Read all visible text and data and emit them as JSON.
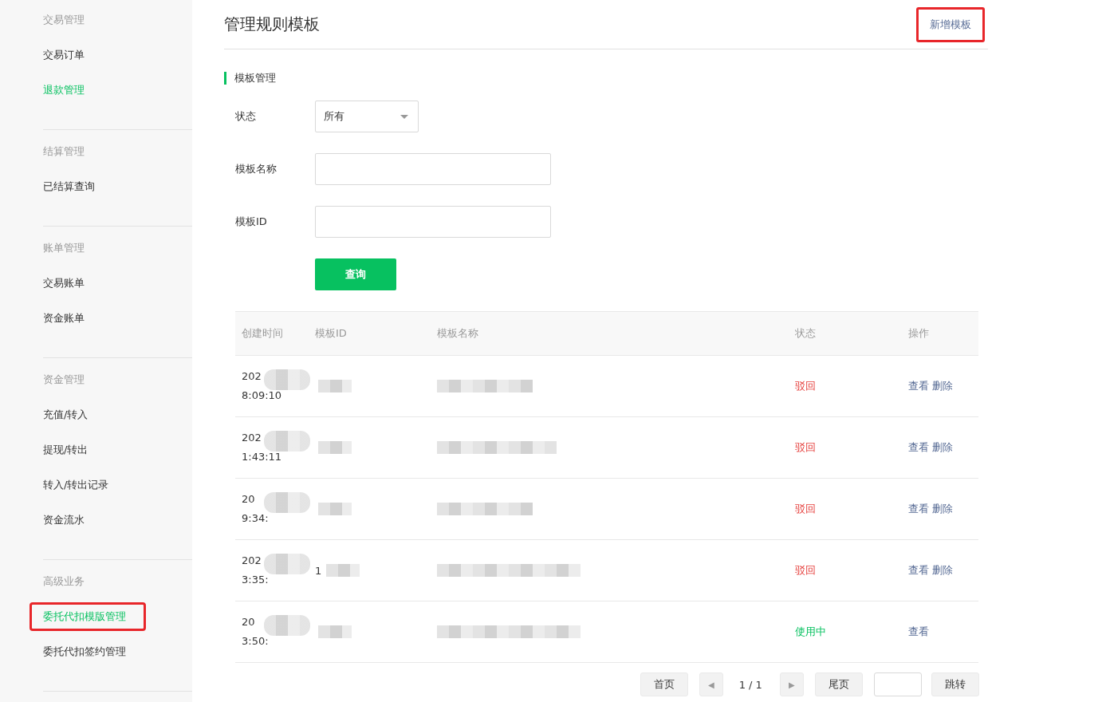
{
  "sidebar": {
    "groups": [
      {
        "title": "交易管理",
        "items": [
          {
            "label": "交易订单",
            "selected": false,
            "highlighted": false
          },
          {
            "label": "退款管理",
            "selected": true,
            "highlighted": false
          }
        ]
      },
      {
        "title": "结算管理",
        "items": [
          {
            "label": "已结算查询",
            "selected": false,
            "highlighted": false
          }
        ]
      },
      {
        "title": "账单管理",
        "items": [
          {
            "label": "交易账单",
            "selected": false,
            "highlighted": false
          },
          {
            "label": "资金账单",
            "selected": false,
            "highlighted": false
          }
        ]
      },
      {
        "title": "资金管理",
        "items": [
          {
            "label": "充值/转入",
            "selected": false,
            "highlighted": false
          },
          {
            "label": "提现/转出",
            "selected": false,
            "highlighted": false
          },
          {
            "label": "转入/转出记录",
            "selected": false,
            "highlighted": false
          },
          {
            "label": "资金流水",
            "selected": false,
            "highlighted": false
          }
        ]
      },
      {
        "title": "高级业务",
        "items": [
          {
            "label": "委托代扣模版管理",
            "selected": true,
            "highlighted": true
          },
          {
            "label": "委托代扣签约管理",
            "selected": false,
            "highlighted": false
          }
        ]
      }
    ]
  },
  "page": {
    "title": "管理规则模板",
    "add_button": {
      "label": "新增模板",
      "highlighted": true
    }
  },
  "section": {
    "title": "模板管理"
  },
  "filters": [
    {
      "kind": "select",
      "label": "状态",
      "value": "所有"
    },
    {
      "kind": "input",
      "label": "模板名称"
    },
    {
      "kind": "input",
      "label": "模板ID"
    }
  ],
  "query_button": "查询",
  "table": {
    "columns": [
      "创建时间",
      "模板ID",
      "模板名称",
      "状态",
      "操作"
    ],
    "rows": [
      {
        "time": [
          "202",
          "8:09:10"
        ],
        "status": "驳回",
        "color": "#e64340",
        "actions": [
          "查看",
          "删除"
        ]
      },
      {
        "time": [
          "202",
          "1:43:11"
        ],
        "status": "驳回",
        "color": "#e64340",
        "actions": [
          "查看",
          "删除"
        ]
      },
      {
        "time": [
          "20",
          "9:34:"
        ],
        "status": "驳回",
        "color": "#e64340",
        "actions": [
          "查看",
          "删除"
        ]
      },
      {
        "time": [
          "202",
          "3:35:"
        ],
        "id": "1",
        "status": "驳回",
        "color": "#e64340",
        "actions": [
          "查看",
          "删除"
        ]
      },
      {
        "time": [
          "20",
          "3:50:"
        ],
        "status": "使用中",
        "color": "#07c160",
        "actions": [
          "查看"
        ]
      }
    ]
  },
  "pagination": {
    "first": "首页",
    "prev": "◀",
    "page": "1 / 1",
    "next": "▶",
    "last": "尾页",
    "jump": "跳转"
  }
}
